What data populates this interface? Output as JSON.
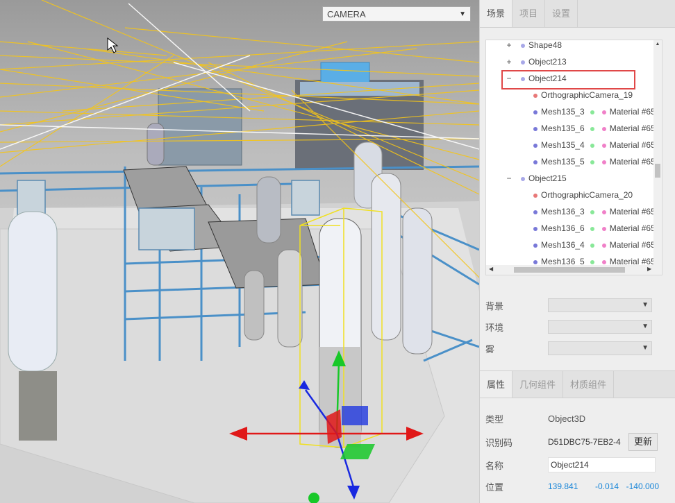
{
  "viewport": {
    "camera_select": "CAMERA"
  },
  "sidebar": {
    "tabs": [
      "场景",
      "项目",
      "设置"
    ],
    "outliner": [
      {
        "depth": 0,
        "toggle": "+",
        "label": "Shape48",
        "dot": "obj"
      },
      {
        "depth": 0,
        "toggle": "+",
        "label": "Object213",
        "dot": "obj"
      },
      {
        "depth": 0,
        "toggle": "−",
        "label": "Object214",
        "dot": "obj",
        "selected": true
      },
      {
        "depth": 1,
        "label": "OrthographicCamera_19",
        "dot": "cam"
      },
      {
        "depth": 1,
        "label": "Mesh135_3",
        "dot": "mesh",
        "material": "Material #65"
      },
      {
        "depth": 1,
        "label": "Mesh135_6",
        "dot": "mesh",
        "material": "Material #65"
      },
      {
        "depth": 1,
        "label": "Mesh135_4",
        "dot": "mesh",
        "material": "Material #65"
      },
      {
        "depth": 1,
        "label": "Mesh135_5",
        "dot": "mesh",
        "material": "Material #65"
      },
      {
        "depth": 0,
        "toggle": "−",
        "label": "Object215",
        "dot": "obj"
      },
      {
        "depth": 1,
        "label": "OrthographicCamera_20",
        "dot": "cam"
      },
      {
        "depth": 1,
        "label": "Mesh136_3",
        "dot": "mesh",
        "material": "Material #65"
      },
      {
        "depth": 1,
        "label": "Mesh136_6",
        "dot": "mesh",
        "material": "Material #65"
      },
      {
        "depth": 1,
        "label": "Mesh136_4",
        "dot": "mesh",
        "material": "Material #65"
      },
      {
        "depth": 1,
        "label": "Mesh136_5",
        "dot": "mesh",
        "material": "Material #65"
      }
    ],
    "scene_props": {
      "background_label": "背景",
      "environment_label": "环境",
      "fog_label": "雾"
    },
    "prop_tabs": [
      "属性",
      "几何组件",
      "材质组件"
    ],
    "object": {
      "type_label": "类型",
      "type_value": "Object3D",
      "uuid_label": "识别码",
      "uuid_value": "D51DBC75-7EB2-4",
      "update_button": "更新",
      "name_label": "名称",
      "name_value": "Object214",
      "position_label": "位置",
      "position": [
        "139.841",
        "-0.014",
        "-140.000"
      ]
    }
  },
  "colors": {
    "selection_outline": "#e04848",
    "light_rays": "#f5c518",
    "gizmo_x": "#e01818",
    "gizmo_y": "#18c828",
    "gizmo_z": "#1828e0",
    "position_value": "#1a86d8"
  }
}
